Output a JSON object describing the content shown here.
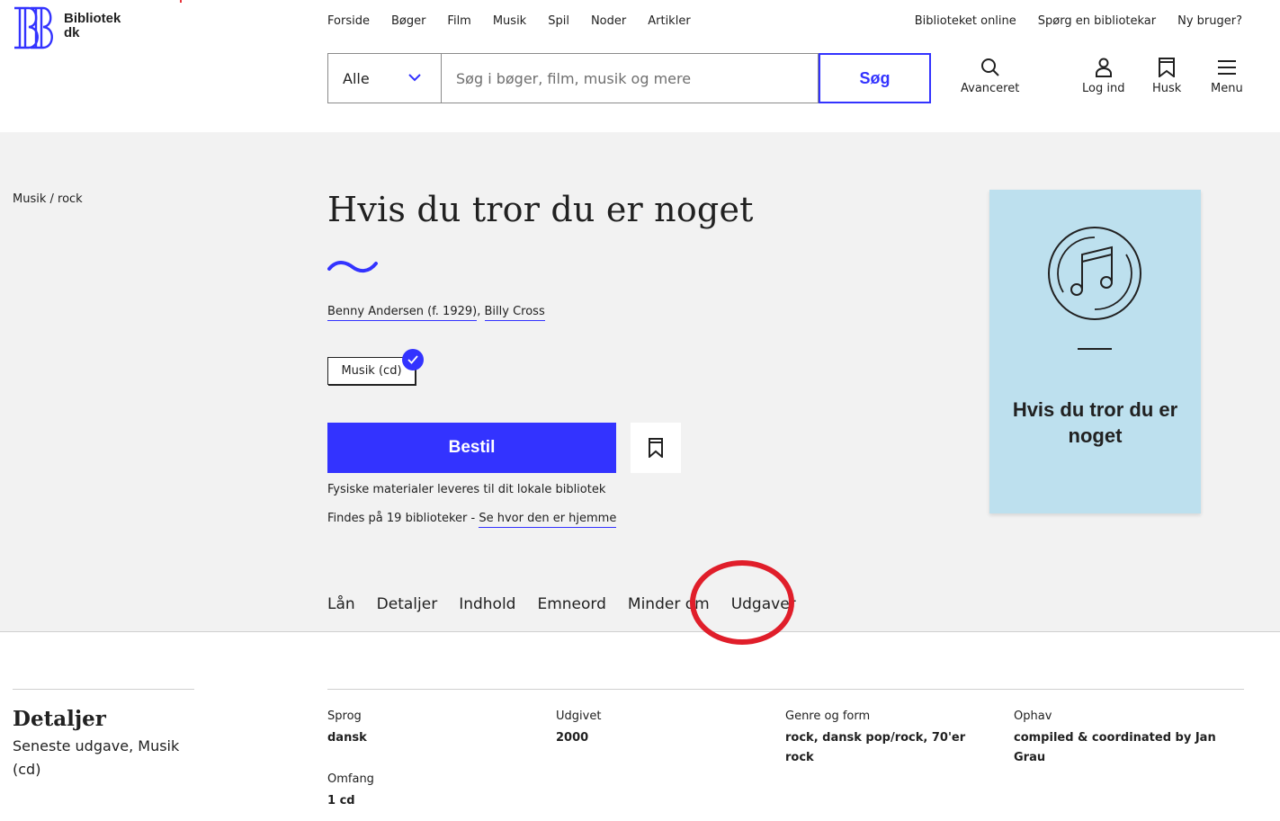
{
  "header": {
    "logo_line1": "Bibliotek",
    "logo_line2": "dk",
    "nav": [
      "Forside",
      "Bøger",
      "Film",
      "Musik",
      "Spil",
      "Noder",
      "Artikler"
    ],
    "nav_right": [
      "Biblioteket online",
      "Spørg en bibliotekar",
      "Ny bruger?"
    ],
    "search": {
      "select_value": "Alle",
      "placeholder": "Søg i bøger, film, musik og mere",
      "button_label": "Søg"
    },
    "actions": {
      "advanced": "Avanceret",
      "login": "Log ind",
      "remember": "Husk",
      "menu": "Menu"
    }
  },
  "hero": {
    "breadcrumb": "Musik / rock",
    "title": "Hvis du tror du er noget",
    "creators": [
      "Benny Andersen (f. 1929)",
      "Billy Cross"
    ],
    "creator_separator": ",",
    "material_type": "Musik (cd)",
    "order_button": "Bestil",
    "delivery_note": "Fysiske materialer leveres til dit lokale bibliotek",
    "availability_prefix": "Findes på 19 biblioteker - ",
    "availability_link": "Se hvor den er hjemme",
    "cover_title": "Hvis du tror du er noget",
    "tabs": [
      "Lån",
      "Detaljer",
      "Indhold",
      "Emneord",
      "Minder om",
      "Udgaver"
    ]
  },
  "details": {
    "heading": "Detaljer",
    "subheading": "Seneste udgave, Musik (cd)",
    "fields": {
      "language": {
        "label": "Sprog",
        "value": "dansk"
      },
      "published": {
        "label": "Udgivet",
        "value": "2000"
      },
      "genre": {
        "label": "Genre og form",
        "value": "rock, dansk pop/rock, 70'er rock"
      },
      "origin": {
        "label": "Ophav",
        "value": "compiled & coordinated by Jan Grau"
      },
      "extent": {
        "label": "Omfang",
        "value": "1 cd"
      }
    }
  },
  "colors": {
    "accent": "#3333ff",
    "hero_bg": "#f2f2f2",
    "cover_bg": "#bde0ee",
    "annotation": "#e01e2a"
  }
}
